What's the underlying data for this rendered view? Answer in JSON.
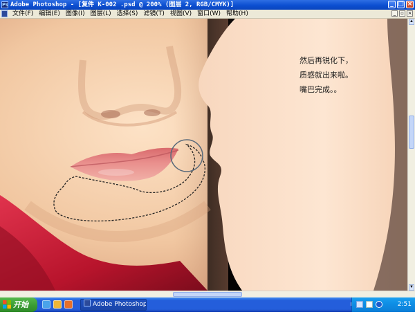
{
  "window": {
    "title": "Adobe Photoshop - [复件 K-002 .psd @ 200% (图层 2, RGB/CMYK)]",
    "buttons": [
      "_",
      "□",
      "×"
    ]
  },
  "menu": {
    "items": [
      {
        "label": "文件(F)"
      },
      {
        "label": "编辑(E)"
      },
      {
        "label": "图像(I)"
      },
      {
        "label": "图层(L)"
      },
      {
        "label": "选择(S)"
      },
      {
        "label": "滤镜(T)"
      },
      {
        "label": "视图(V)"
      },
      {
        "label": "窗口(W)"
      },
      {
        "label": "帮助(H)"
      }
    ]
  },
  "annotation": {
    "lines": [
      "然后再锐化下，",
      "质感就出来啦。",
      "嘴巴完成。。"
    ]
  },
  "taskbar": {
    "start_label": "开始",
    "task_button_label": "Adobe Photoshop ...",
    "language": "EN",
    "clock": "2:51"
  },
  "colors": {
    "titlebar_blue": "#0c4fd1",
    "menubar_bg": "#ece9d8",
    "start_green": "#3a9c33",
    "taskbar_blue": "#245edb",
    "scarf_red": "#c81f3a",
    "skin": "#f3cfae"
  }
}
